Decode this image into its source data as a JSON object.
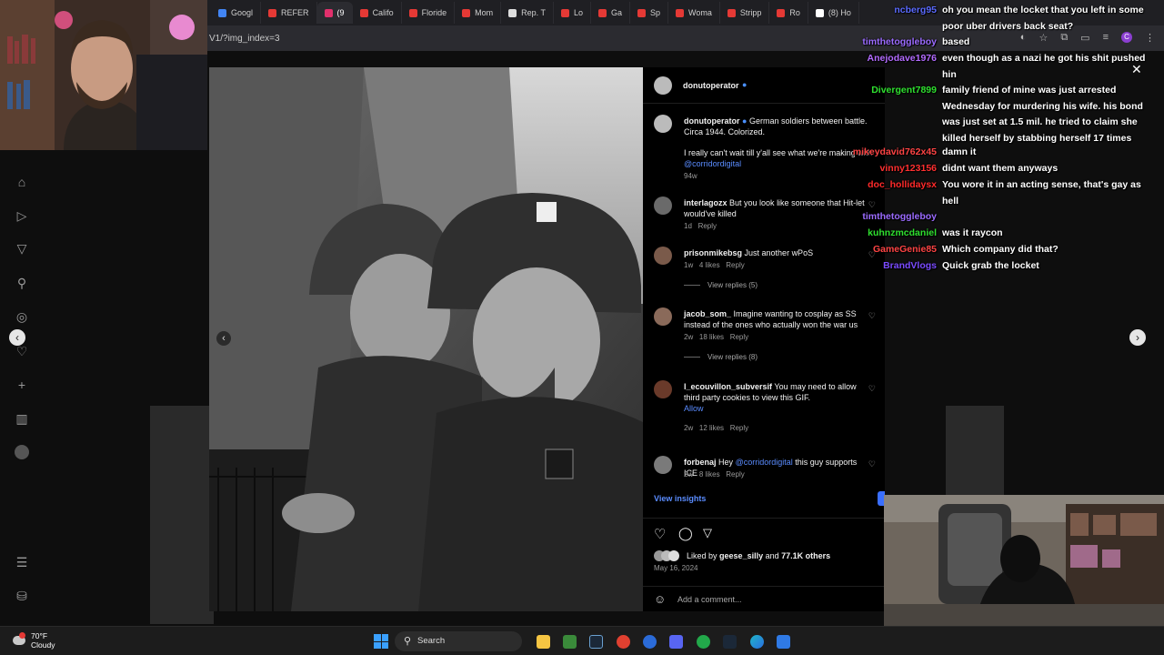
{
  "browser": {
    "tabs": [
      {
        "label": "Googl",
        "color": "#4285f4"
      },
      {
        "label": "REFER",
        "color": "#e53935"
      },
      {
        "label": "(9",
        "color": "#e1306c",
        "active": true
      },
      {
        "label": "Califo",
        "color": "#e53935"
      },
      {
        "label": "Floride",
        "color": "#e53935"
      },
      {
        "label": "Mom",
        "color": "#e53935"
      },
      {
        "label": "Rep. T",
        "color": "#dddddd"
      },
      {
        "label": "Lo",
        "color": "#e53935"
      },
      {
        "label": "Ga",
        "color": "#e53935"
      },
      {
        "label": "Sp",
        "color": "#e53935"
      },
      {
        "label": "Woma",
        "color": "#e53935"
      },
      {
        "label": "Stripp",
        "color": "#e53935"
      },
      {
        "label": "Ro",
        "color": "#e53935"
      },
      {
        "label": "(8) Ho",
        "color": "#ffffff"
      }
    ],
    "url": "V1/?img_index=3"
  },
  "post": {
    "header_user": "donutoperator",
    "caption_user": "donutoperator",
    "caption": "German soldiers between battle. Circa 1944. Colorized.",
    "caption2": "I really can't wait till y'all see what we're making with",
    "caption_mention": "@corridordigital",
    "caption_time": "94w",
    "comments": [
      {
        "user": "interlagozx",
        "text": "But you look like someone that Hit-let would've killed",
        "time": "1d",
        "likes": "",
        "reply": "Reply"
      },
      {
        "user": "prisonmikebsg",
        "text": "Just another wPoS",
        "time": "1w",
        "likes": "4 likes",
        "reply": "Reply",
        "replies": "View replies (5)"
      },
      {
        "user": "jacob_som_",
        "text": "Imagine wanting to cosplay as SS instead of the ones who actually won the war us",
        "time": "2w",
        "likes": "18 likes",
        "reply": "Reply",
        "replies": "View replies (8)"
      },
      {
        "user": "l_ecouvillon_subversif",
        "text": "You may need to allow third party cookies to view this GIF.",
        "allow": "Allow",
        "time": "2w",
        "likes": "12 likes",
        "reply": "Reply"
      },
      {
        "user": "forbenaj",
        "text_prefix": "Hey",
        "mention": "@corridordigital",
        "text": "this guy supports ICE",
        "time": "2w",
        "likes": "8 likes",
        "reply": "Reply"
      }
    ],
    "view_insights": "View insights",
    "liked_by_prefix": "Liked by",
    "liked_by_user": "geese_silly",
    "liked_by_and": "and",
    "liked_by_others": "77.1K others",
    "date": "May 16, 2024",
    "add_comment": "Add a comment..."
  },
  "chat": [
    {
      "name": "ncberg95",
      "color": "#5b6bff",
      "msg": "oh you mean the locket that you left in some poor uber drivers back seat?"
    },
    {
      "name": "timthetoggleboy",
      "color": "#9b6bff",
      "msg": "based"
    },
    {
      "name": "Anejodave1976",
      "color": "#b36bff",
      "msg": "even though as a nazi he got his shit pushed hin"
    },
    {
      "name": "Divergent7899",
      "color": "#2fe02f",
      "msg": "family friend of mine was just arrested Wednesday for murdering his wife. his bond was just set at 1.5 mil. he tried to claim she killed herself by stabbing herself 17 times"
    },
    {
      "name": "mikeydavid762x45",
      "color": "#ff4444",
      "msg": "damn it"
    },
    {
      "name": "vinny123156",
      "color": "#ff3030",
      "msg": "didnt want them anyways"
    },
    {
      "name": "doc_hollidaysx",
      "color": "#ff2a2a",
      "msg": "You wore it in an acting sense, that's gay as hell"
    },
    {
      "name": "timthetoggleboy",
      "color": "#9b6bff",
      "msg": ""
    },
    {
      "name": "kuhnzmcdaniel",
      "color": "#2fe02f",
      "msg": "was it raycon"
    },
    {
      "name": "GameGenie85",
      "color": "#ff4444",
      "msg": "Which company did that?"
    },
    {
      "name": "BrandVlogs",
      "color": "#7a4bff",
      "msg": "Quick grab the locket"
    }
  ],
  "taskbar": {
    "weather_temp": "70°F",
    "weather_desc": "Cloudy",
    "search_label": "Search"
  }
}
